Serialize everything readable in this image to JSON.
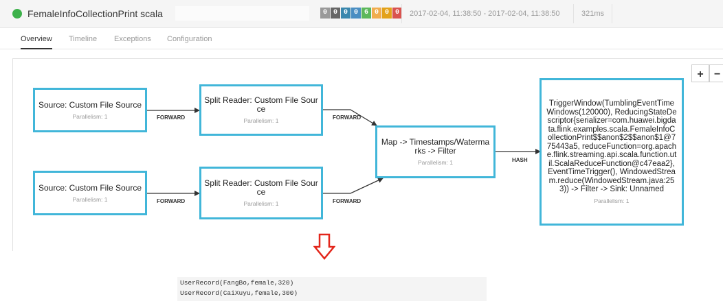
{
  "header": {
    "job_name": "FemaleInfoCollectionPrint scala",
    "task_counts": [
      "0",
      "0",
      "0",
      "0",
      "6",
      "0",
      "0",
      "0"
    ],
    "time_range": "2017-02-04, 11:38:50 - 2017-02-04, 11:38:50",
    "duration": "321ms"
  },
  "tabs": [
    {
      "label": "Overview",
      "active": true
    },
    {
      "label": "Timeline",
      "active": false
    },
    {
      "label": "Exceptions",
      "active": false
    },
    {
      "label": "Configuration",
      "active": false
    }
  ],
  "zoom": {
    "in": "+",
    "out": "−"
  },
  "plan": {
    "nodes": {
      "source1": {
        "title": "Source: Custom File Source",
        "parallelism": "Parallelism: 1"
      },
      "split1": {
        "title": "Split Reader: Custom File Source",
        "parallelism": "Parallelism: 1"
      },
      "source2": {
        "title": "Source: Custom File Source",
        "parallelism": "Parallelism: 1"
      },
      "split2": {
        "title": "Split Reader: Custom File Source",
        "parallelism": "Parallelism: 1"
      },
      "map": {
        "title": "Map -> Timestamps/Watermarks -> Filter",
        "parallelism": "Parallelism: 1"
      },
      "window": {
        "title": "TriggerWindow(TumblingEventTimeWindows(120000), ReducingStateDescriptor{serializer=com.huawei.bigdata.flink.examples.scala.FemaleInfoCollectionPrint$$anon$2$$anon$1@775443a5, reduceFunction=org.apache.flink.streaming.api.scala.function.util.ScalaReduceFunction@c47eaa2}, EventTimeTrigger(), WindowedStream.reduce(WindowedStream.java:253)) -> Filter -> Sink: Unnamed",
        "parallelism": "Parallelism: 1"
      }
    },
    "edges": {
      "e1": "FORWARD",
      "e2": "FORWARD",
      "e3": "FORWARD",
      "e4": "FORWARD",
      "e5": "HASH"
    }
  },
  "output": {
    "lines": [
      "UserRecord(FangBo,female,320)",
      "UserRecord(CaiXuyu,female,300)"
    ]
  },
  "colors": {
    "node_border": "#41b6d9",
    "status_running": "#3cb14a",
    "arrow_red": "#e3261b"
  }
}
